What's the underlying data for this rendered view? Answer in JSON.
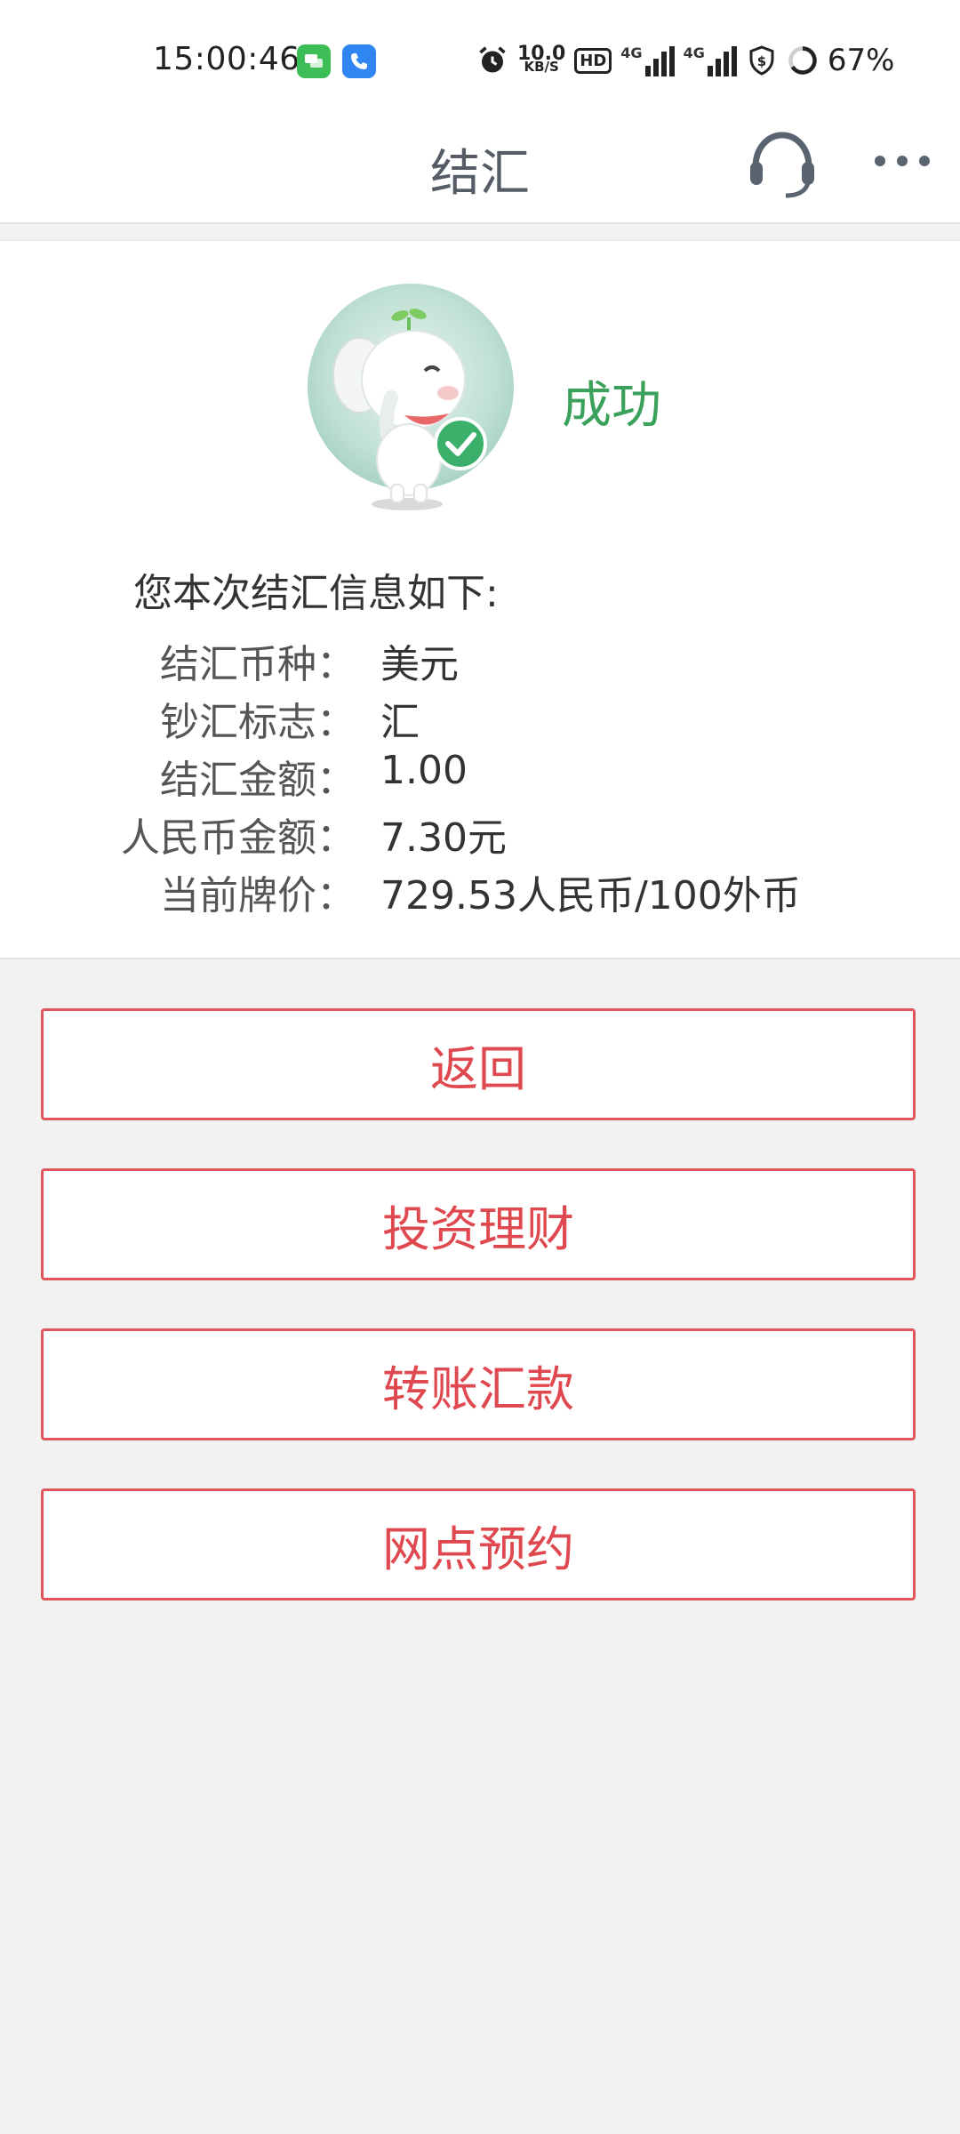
{
  "status_bar": {
    "time": "15:00:46",
    "net_speed_value": "10.0",
    "net_speed_unit": "KB/S",
    "hd_label": "HD",
    "signal1_label": "4G",
    "signal2_label": "4G",
    "battery": "67%",
    "icons": [
      "messages-app-icon",
      "phone-app-icon",
      "alarm-icon",
      "hd-voice-icon",
      "signal-icon",
      "signal-icon",
      "shield-icon",
      "battery-ring-icon"
    ]
  },
  "header": {
    "title": "结汇",
    "service_icon": "headset-icon",
    "more_icon": "more-dots-icon"
  },
  "result": {
    "status": "成功",
    "mascot_icon": "elephant-success-mascot",
    "heading": "您本次结汇信息如下:",
    "rows": [
      {
        "label": "结汇币种：",
        "value": "美元"
      },
      {
        "label": "钞汇标志：",
        "value": "汇"
      },
      {
        "label": "结汇金额：",
        "value": "1.00"
      },
      {
        "label": "人民币金额：",
        "value": "7.30元"
      },
      {
        "label": "当前牌价：",
        "value": "729.53人民币/100外币"
      }
    ]
  },
  "actions": [
    {
      "label": "返回"
    },
    {
      "label": "投资理财"
    },
    {
      "label": "转账汇款"
    },
    {
      "label": "网点预约"
    }
  ],
  "colors": {
    "accent": "#e0484f",
    "success": "#3aa15a",
    "background": "#f2f2f2"
  }
}
